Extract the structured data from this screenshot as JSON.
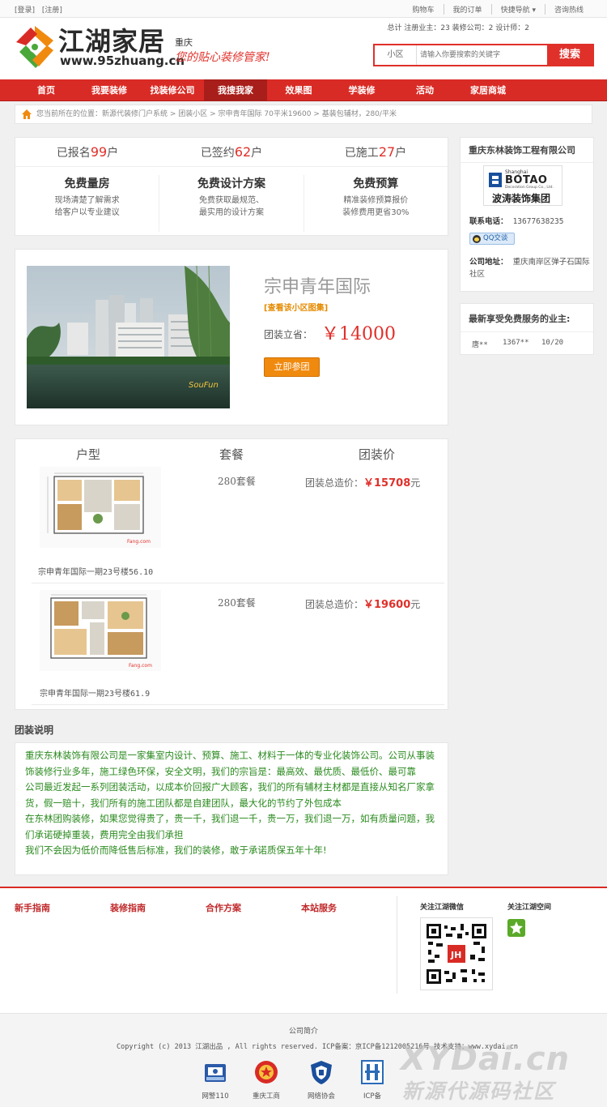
{
  "topbar": {
    "login": "[登录]",
    "register": "[注册]",
    "links": [
      "购物车",
      "我的订单",
      "快捷导航",
      "咨询热线"
    ]
  },
  "header": {
    "brand": "江湖家居",
    "url": "www.95zhuang.cn",
    "city": "重庆",
    "slogan": "您的贴心装修管家!",
    "stats": "总计 注册业主：23 装修公司：2 设计师：2"
  },
  "search": {
    "category": "小区",
    "placeholder": "请输入你要搜索的关键字",
    "button": "搜索"
  },
  "nav": [
    "首页",
    "我要装修",
    "找装修公司",
    "我搜我家",
    "效果图",
    "学装修",
    "活动",
    "家居商城"
  ],
  "breadcrumb": "您当前所在的位置：新源代装修门户系统 > 团装小区 > 宗申青年国际 70平米19600 > 基装包辅材，280/平米",
  "counts": {
    "signed_up": {
      "prefix": "已报名",
      "value": "99",
      "unit": "户"
    },
    "contracted": {
      "prefix": "已签约",
      "value": "62",
      "unit": "户"
    },
    "constructed": {
      "prefix": "已施工",
      "value": "27",
      "unit": "户"
    }
  },
  "free_services": [
    {
      "title": "免费量房",
      "line1": "现场清楚了解需求",
      "line2": "给客户以专业建议"
    },
    {
      "title": "免费设计方案",
      "line1": "免费获取最规范、",
      "line2": "最实用的设计方案"
    },
    {
      "title": "免费预算",
      "line1": "精准装修预算报价",
      "line2": "装修费用更省30%"
    }
  ],
  "project": {
    "title": "宗申青年国际",
    "album_link": "[查看该小区图集]",
    "price_label": "团装立省：",
    "price": "￥14000",
    "join_button": "立即参团"
  },
  "plans_table": {
    "headers": [
      "户型",
      "套餐",
      "团装价"
    ],
    "rows": [
      {
        "caption": "宗申青年国际一期23号楼56.10",
        "package": "280套餐",
        "total_label": "团装总造价：",
        "total": "￥15708",
        "unit": "元"
      },
      {
        "caption": "宗申青年国际一期23号楼61.9",
        "package": "280套餐",
        "total_label": "团装总造价：",
        "total": "￥19600",
        "unit": "元"
      }
    ]
  },
  "company": {
    "name": "重庆东林装饰工程有限公司",
    "logo_line1": "Shanghai",
    "logo_line2": "BOTAO",
    "logo_line3": "Decoration Group Co., Ltd.",
    "logo_cn": "波涛装饰集团",
    "phone_label": "联系电话：",
    "phone": "13677638235",
    "qq": "QQ交谈",
    "address_label": "公司地址：",
    "address": "重庆南岸区弹子石国际社区"
  },
  "latest": {
    "title": "最新享受免费服务的业主:",
    "items": [
      {
        "name": "唐**",
        "phone": "1367**",
        "date": "10/20"
      }
    ]
  },
  "explain": {
    "title": "团装说明",
    "paragraphs": [
      "重庆东林装饰有限公司是一家集室内设计、预算、施工、材料于一体的专业化装饰公司。公司从事装饰装修行业多年，施工绿色环保，安全文明，我们的宗旨是：最高效、最优质、最低价、最可靠",
      "公司最近发起一系列团装活动，以成本价回报广大顾客，我们的所有辅材主材都是直接从知名厂家拿货，假一赔十，我们所有的施工团队都是自建团队，最大化的节约了外包成本",
      "在东林团购装修，如果您觉得贵了，贵一千，我们退一千，贵一万，我们退一万，如有质量问题，我们承诺硬掉重装，费用完全由我们承担",
      "我们不会因为低价而降低售后标准，我们的装修，敢于承诺质保五年十年!"
    ]
  },
  "footer": {
    "columns": [
      "新手指南",
      "装修指南",
      "合作方案",
      "本站服务"
    ],
    "wechat_title": "关注江湖微信",
    "qzone_title": "关注江湖空间",
    "intro": "公司简介",
    "copyright": "Copyright (c) 2013  江湖出品 , All rights reserved. ICP备案：京ICP备1212005216号 技术支持：www.xydai.cn",
    "badges": [
      "网警110",
      "重庆工商",
      "网络协会",
      "ICP备"
    ]
  },
  "watermark": {
    "line1": "XYDai.cn",
    "line2": "新源代源码社区"
  },
  "colors": {
    "brand_red": "#d92b25",
    "price_red": "#e0302a",
    "orange": "#f08a0f",
    "green_text": "#2a8a1e"
  }
}
